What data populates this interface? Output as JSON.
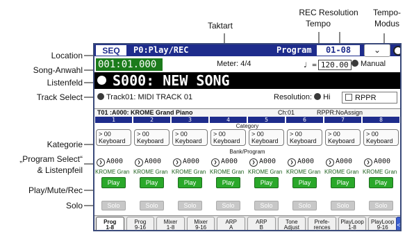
{
  "annotations": {
    "taktart": "Taktart",
    "rec_res_line1": "REC Resolution",
    "rec_res_line2": "Tempo",
    "tempo_modus_line1": "Tempo-",
    "tempo_modus_line2": "Modus",
    "location": "Location",
    "song_anwahl": "Song-Anwahl",
    "listenfeld": "Listenfeld",
    "track_select": "Track Select",
    "kategorie": "Kategorie",
    "program_select_line1": "„Program Select“",
    "program_select_line2": "& Listenpfeil",
    "play_mute_rec": "Play/Mute/Rec",
    "solo": "Solo"
  },
  "header": {
    "mode": "SEQ",
    "page": "P0:Play/REC",
    "program_label": "Program",
    "program_range": "01-08",
    "menu_icon": "chevron-down"
  },
  "transport": {
    "location": "001:01.000",
    "meter_label": "Meter:",
    "meter": "4/4",
    "tempo_symbol": "♩ =",
    "tempo": "120.00",
    "tempo_mode": "Manual"
  },
  "song": {
    "name": "S000: NEW SONG"
  },
  "track": {
    "selected": "Track01: MIDI TRACK 01",
    "resolution_label": "Resolution:",
    "resolution": "Hi",
    "rppr_label": "RPPR"
  },
  "track_info": {
    "title": "T01 :A000: KROME Grand Piano",
    "channel": "Ch:01",
    "rppr": "RPPR:NoAssign"
  },
  "section_labels": {
    "category": "Category",
    "bank_program": "Bank/Program"
  },
  "tracks": [
    {
      "num": "1",
      "cat_num": "> 00",
      "cat": "Keyboard",
      "program": "A000",
      "pname": "KROME Gran",
      "play": "Play",
      "solo": "Solo"
    },
    {
      "num": "2",
      "cat_num": "> 00",
      "cat": "Keyboard",
      "program": "A000",
      "pname": "KROME Gran",
      "play": "Play",
      "solo": "Solo"
    },
    {
      "num": "3",
      "cat_num": "> 00",
      "cat": "Keyboard",
      "program": "A000",
      "pname": "KROME Gran",
      "play": "Play",
      "solo": "Solo"
    },
    {
      "num": "4",
      "cat_num": "> 00",
      "cat": "Keyboard",
      "program": "A000",
      "pname": "KROME Gran",
      "play": "Play",
      "solo": "Solo"
    },
    {
      "num": "5",
      "cat_num": "> 00",
      "cat": "Keyboard",
      "program": "A000",
      "pname": "KROME Gran",
      "play": "Play",
      "solo": "Solo"
    },
    {
      "num": "6",
      "cat_num": "> 00",
      "cat": "Keyboard",
      "program": "A000",
      "pname": "KROME Gran",
      "play": "Play",
      "solo": "Solo"
    },
    {
      "num": "7",
      "cat_num": "> 00",
      "cat": "Keyboard",
      "program": "A000",
      "pname": "KROME Gran",
      "play": "Play",
      "solo": "Solo"
    },
    {
      "num": "8",
      "cat_num": "> 00",
      "cat": "Keyboard",
      "program": "A000",
      "pname": "KROME Gran",
      "play": "Play",
      "solo": "Solo"
    }
  ],
  "bottom_tabs": [
    {
      "l1": "Prog",
      "l2": "1-8"
    },
    {
      "l1": "Prog",
      "l2": "9-16"
    },
    {
      "l1": "Mixer",
      "l2": "1-8"
    },
    {
      "l1": "Mixer",
      "l2": "9-16"
    },
    {
      "l1": "ARP",
      "l2": "A"
    },
    {
      "l1": "ARP",
      "l2": "B"
    },
    {
      "l1": "Tone",
      "l2": "Adjust"
    },
    {
      "l1": "Prefe-",
      "l2": "rences"
    },
    {
      "l1": "PlayLoop",
      "l2": "1-8"
    },
    {
      "l1": "PlayLoop",
      "l2": "9-16"
    }
  ],
  "colors": {
    "header_blue": "#1e2c8c",
    "location_green": "#1b7b1b",
    "play_green": "#2aa82a"
  }
}
